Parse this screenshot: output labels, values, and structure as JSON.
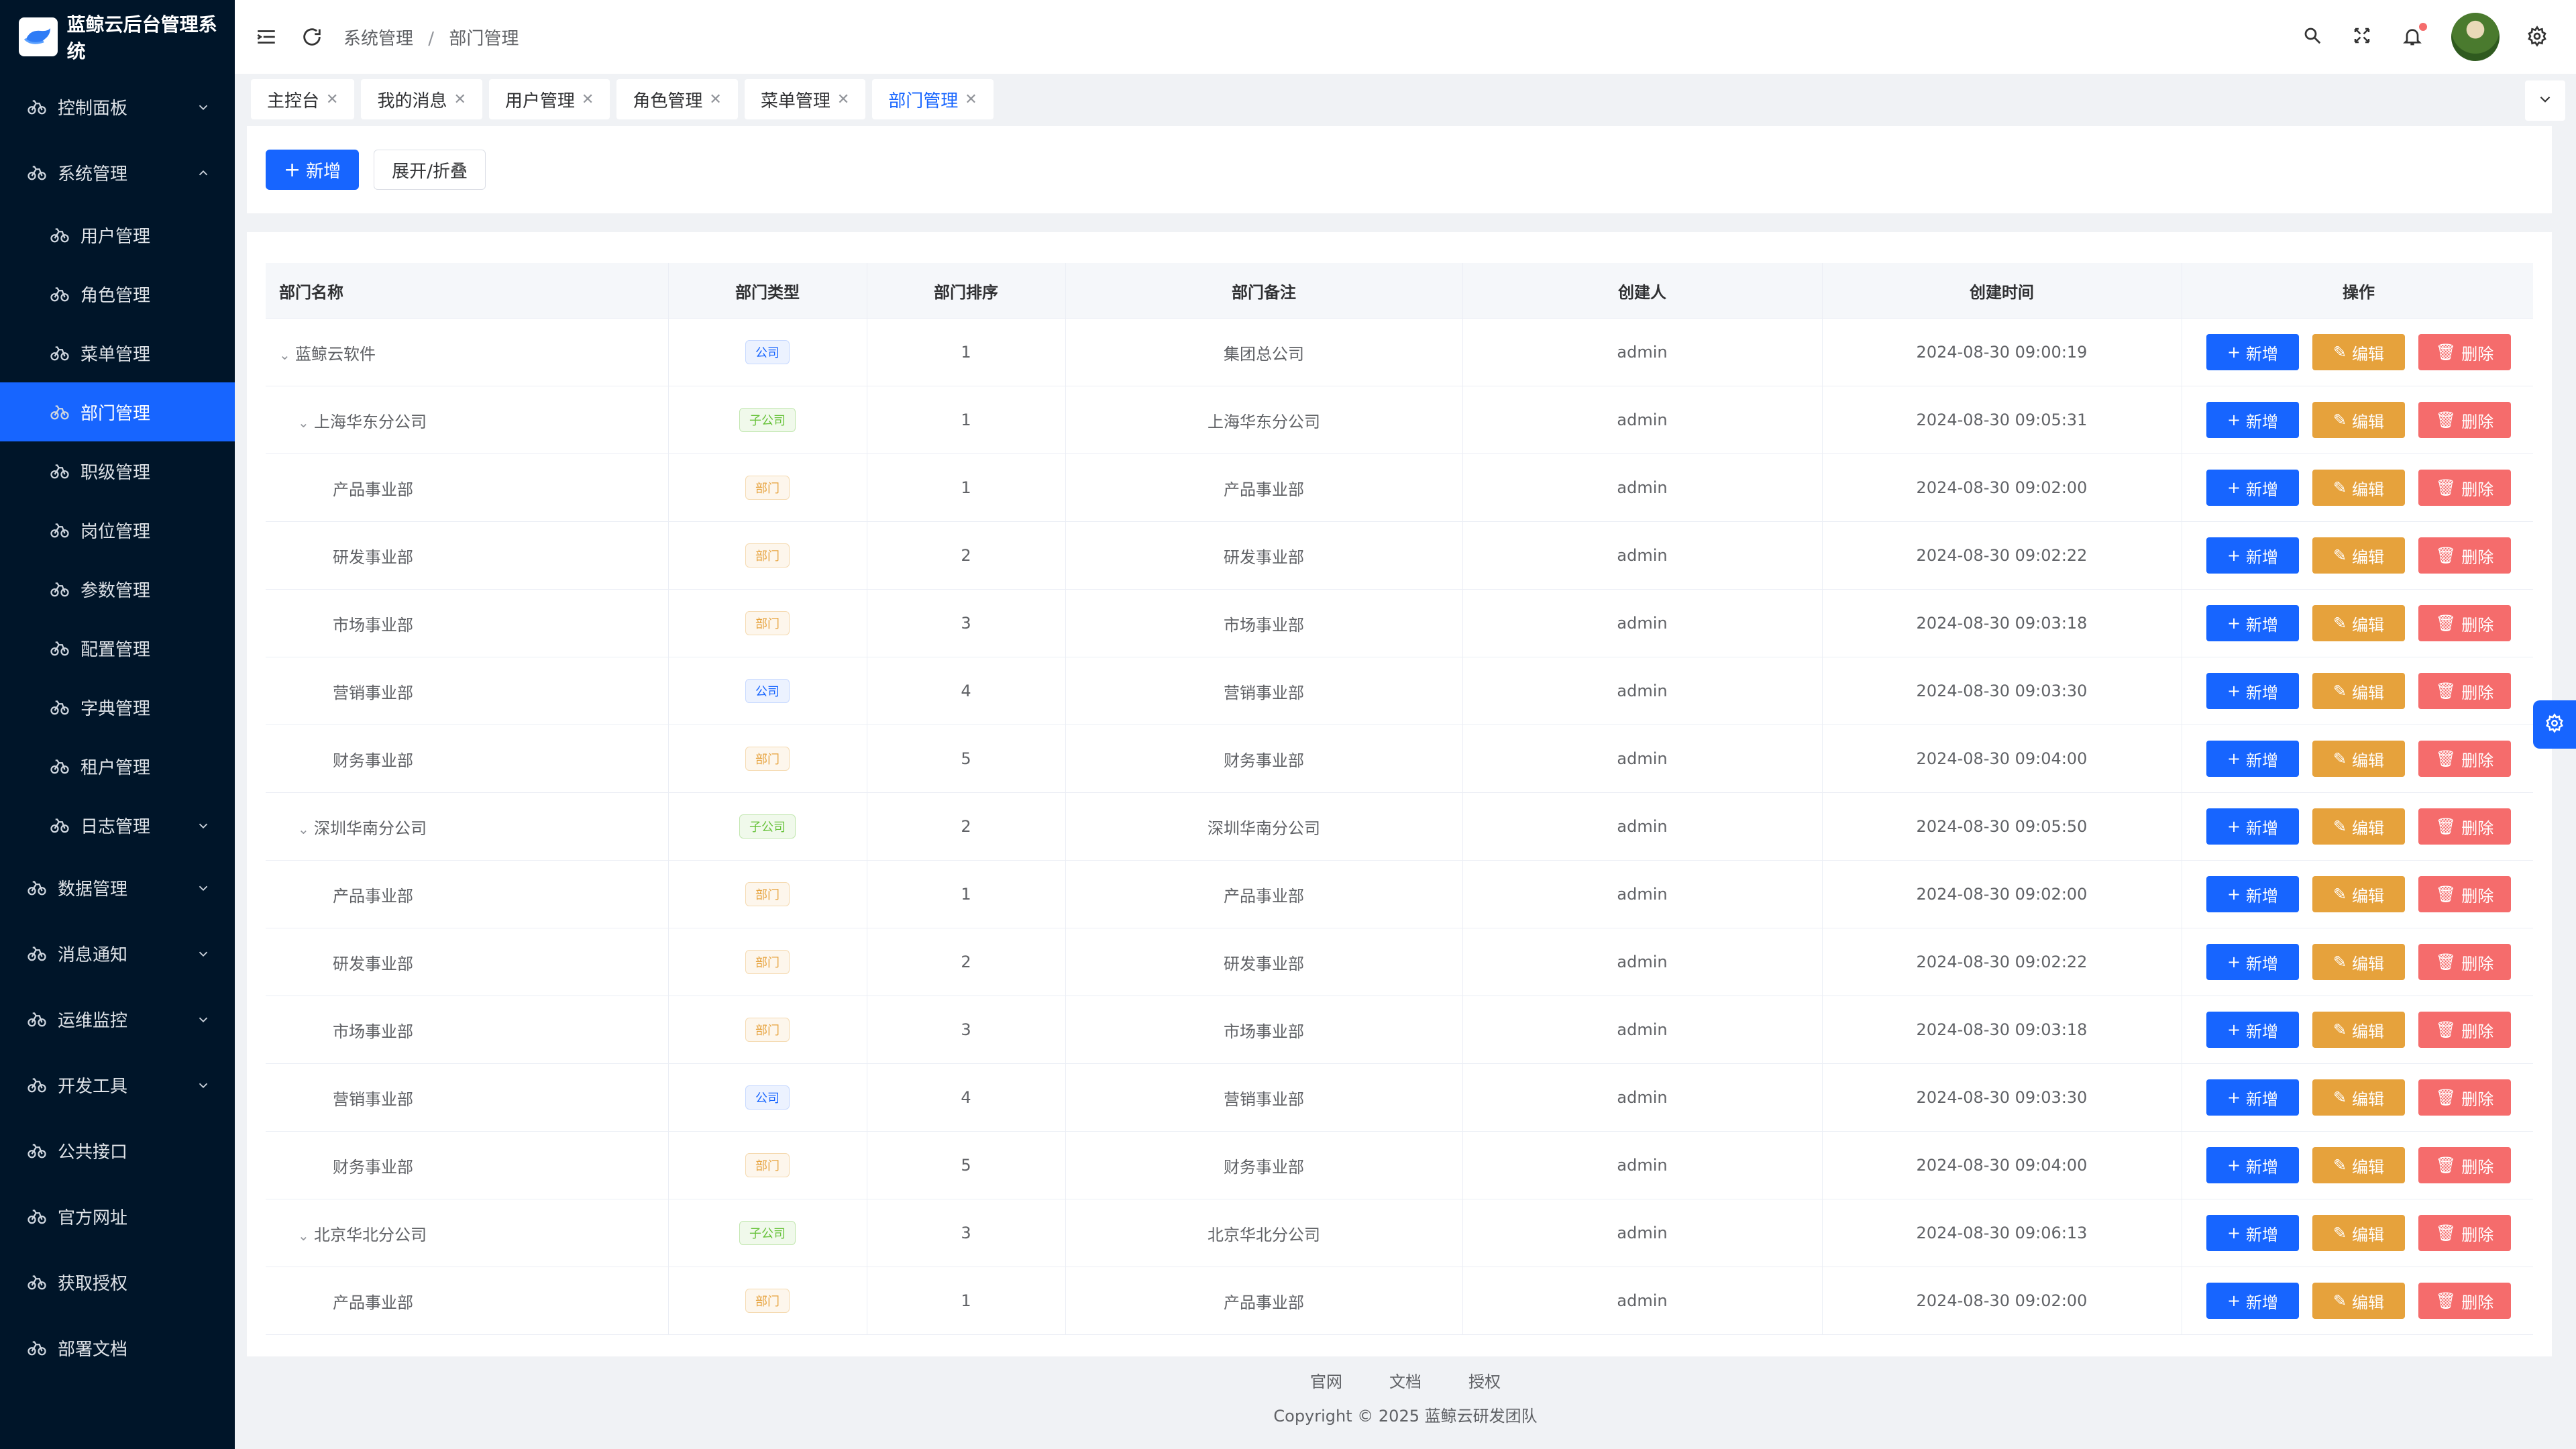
{
  "app": {
    "title": "蓝鲸云后台管理系统"
  },
  "sidebar": {
    "items": [
      {
        "label": "控制面板",
        "level": "top",
        "expandable": true
      },
      {
        "label": "系统管理",
        "level": "top",
        "expandable": true,
        "expanded": true
      },
      {
        "label": "用户管理",
        "level": "sub"
      },
      {
        "label": "角色管理",
        "level": "sub"
      },
      {
        "label": "菜单管理",
        "level": "sub"
      },
      {
        "label": "部门管理",
        "level": "sub",
        "active": true
      },
      {
        "label": "职级管理",
        "level": "sub"
      },
      {
        "label": "岗位管理",
        "level": "sub"
      },
      {
        "label": "参数管理",
        "level": "sub"
      },
      {
        "label": "配置管理",
        "level": "sub"
      },
      {
        "label": "字典管理",
        "level": "sub"
      },
      {
        "label": "租户管理",
        "level": "sub"
      },
      {
        "label": "日志管理",
        "level": "sub",
        "expandable": true
      },
      {
        "label": "数据管理",
        "level": "top",
        "expandable": true
      },
      {
        "label": "消息通知",
        "level": "top",
        "expandable": true
      },
      {
        "label": "运维监控",
        "level": "top",
        "expandable": true
      },
      {
        "label": "开发工具",
        "level": "top",
        "expandable": true
      },
      {
        "label": "公共接口",
        "level": "top"
      },
      {
        "label": "官方网址",
        "level": "top"
      },
      {
        "label": "获取授权",
        "level": "top"
      },
      {
        "label": "部署文档",
        "level": "top"
      }
    ]
  },
  "header": {
    "breadcrumb": [
      "系统管理",
      "部门管理"
    ],
    "icons": [
      "menu-fold-icon",
      "refresh-icon",
      "search-icon",
      "fullscreen-icon",
      "bell-icon",
      "avatar",
      "gear-icon"
    ]
  },
  "tabs": [
    {
      "label": "主控台"
    },
    {
      "label": "我的消息"
    },
    {
      "label": "用户管理"
    },
    {
      "label": "角色管理"
    },
    {
      "label": "菜单管理"
    },
    {
      "label": "部门管理",
      "active": true
    }
  ],
  "toolbar": {
    "add_label": "新增",
    "toggle_label": "展开/折叠"
  },
  "table": {
    "headers": [
      "部门名称",
      "部门类型",
      "部门排序",
      "部门备注",
      "创建人",
      "创建时间",
      "操作"
    ],
    "actions": {
      "add": "新增",
      "edit": "编辑",
      "delete": "删除"
    },
    "rows": [
      {
        "name": "蓝鲸云软件",
        "depth": 0,
        "arrow": true,
        "type": "公司",
        "type_kind": "company",
        "sort": "1",
        "remark": "集团总公司",
        "creator": "admin",
        "time": "2024-08-30 09:00:19"
      },
      {
        "name": "上海华东分公司",
        "depth": 1,
        "arrow": true,
        "type": "子公司",
        "type_kind": "sub",
        "sort": "1",
        "remark": "上海华东分公司",
        "creator": "admin",
        "time": "2024-08-30 09:05:31"
      },
      {
        "name": "产品事业部",
        "depth": 2,
        "type": "部门",
        "type_kind": "dept",
        "sort": "1",
        "remark": "产品事业部",
        "creator": "admin",
        "time": "2024-08-30 09:02:00"
      },
      {
        "name": "研发事业部",
        "depth": 2,
        "type": "部门",
        "type_kind": "dept",
        "sort": "2",
        "remark": "研发事业部",
        "creator": "admin",
        "time": "2024-08-30 09:02:22"
      },
      {
        "name": "市场事业部",
        "depth": 2,
        "type": "部门",
        "type_kind": "dept",
        "sort": "3",
        "remark": "市场事业部",
        "creator": "admin",
        "time": "2024-08-30 09:03:18"
      },
      {
        "name": "营销事业部",
        "depth": 2,
        "type": "公司",
        "type_kind": "company",
        "sort": "4",
        "remark": "营销事业部",
        "creator": "admin",
        "time": "2024-08-30 09:03:30"
      },
      {
        "name": "财务事业部",
        "depth": 2,
        "type": "部门",
        "type_kind": "dept",
        "sort": "5",
        "remark": "财务事业部",
        "creator": "admin",
        "time": "2024-08-30 09:04:00"
      },
      {
        "name": "深圳华南分公司",
        "depth": 1,
        "arrow": true,
        "type": "子公司",
        "type_kind": "sub",
        "sort": "2",
        "remark": "深圳华南分公司",
        "creator": "admin",
        "time": "2024-08-30 09:05:50"
      },
      {
        "name": "产品事业部",
        "depth": 2,
        "type": "部门",
        "type_kind": "dept",
        "sort": "1",
        "remark": "产品事业部",
        "creator": "admin",
        "time": "2024-08-30 09:02:00"
      },
      {
        "name": "研发事业部",
        "depth": 2,
        "type": "部门",
        "type_kind": "dept",
        "sort": "2",
        "remark": "研发事业部",
        "creator": "admin",
        "time": "2024-08-30 09:02:22"
      },
      {
        "name": "市场事业部",
        "depth": 2,
        "type": "部门",
        "type_kind": "dept",
        "sort": "3",
        "remark": "市场事业部",
        "creator": "admin",
        "time": "2024-08-30 09:03:18"
      },
      {
        "name": "营销事业部",
        "depth": 2,
        "type": "公司",
        "type_kind": "company",
        "sort": "4",
        "remark": "营销事业部",
        "creator": "admin",
        "time": "2024-08-30 09:03:30"
      },
      {
        "name": "财务事业部",
        "depth": 2,
        "type": "部门",
        "type_kind": "dept",
        "sort": "5",
        "remark": "财务事业部",
        "creator": "admin",
        "time": "2024-08-30 09:04:00"
      },
      {
        "name": "北京华北分公司",
        "depth": 1,
        "arrow": true,
        "type": "子公司",
        "type_kind": "sub",
        "sort": "3",
        "remark": "北京华北分公司",
        "creator": "admin",
        "time": "2024-08-30 09:06:13"
      },
      {
        "name": "产品事业部",
        "depth": 2,
        "type": "部门",
        "type_kind": "dept",
        "sort": "1",
        "remark": "产品事业部",
        "creator": "admin",
        "time": "2024-08-30 09:02:00"
      }
    ]
  },
  "footer": {
    "links": [
      "官网",
      "文档",
      "授权"
    ],
    "copyright": "Copyright © 2025 蓝鲸云研发团队"
  },
  "colors": {
    "primary": "#1765ff",
    "warning": "#e6a23c",
    "danger": "#f56c6c",
    "sidebar_bg": "#001529"
  }
}
